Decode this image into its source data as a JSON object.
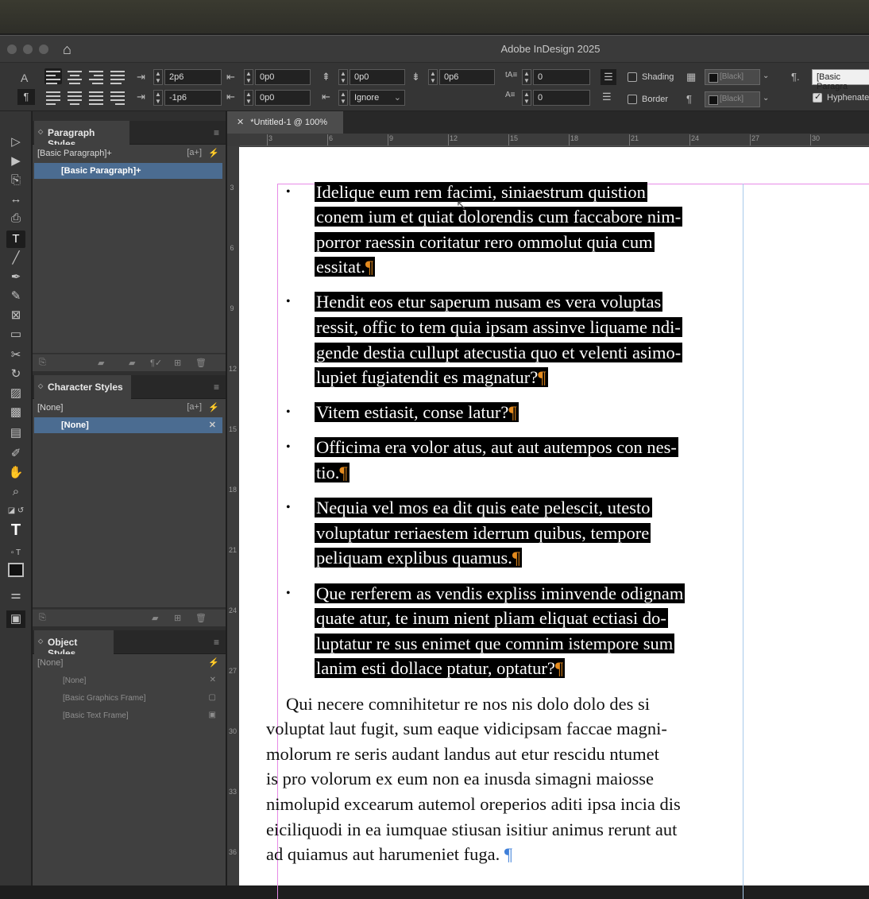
{
  "app": {
    "title": "Adobe InDesign 2025"
  },
  "control": {
    "left_indent": "2p6",
    "first_indent": "-1p6",
    "right_indent": "0p0",
    "last_indent": "0p0",
    "space_before": "0p0",
    "space_after": "0p6",
    "grid_align": "Ignore",
    "drop_lines": "0",
    "drop_chars": "0",
    "shading_label": "Shading",
    "border_label": "Border",
    "shading_swatch": "[Black]",
    "border_swatch": "[Black]",
    "style": "[Basic Paragra",
    "hyphenate_label": "Hyphenate"
  },
  "panels": {
    "paragraph_styles": {
      "title": "Paragraph Styles",
      "current": "[Basic Paragraph]+",
      "items": [
        "[Basic Paragraph]+"
      ]
    },
    "character_styles": {
      "title": "Character Styles",
      "current": "[None]",
      "items": [
        "[None]"
      ]
    },
    "object_styles": {
      "title": "Object Styles",
      "current": "[None]",
      "items": [
        "[None]",
        "[Basic Graphics Frame]",
        "[Basic Text Frame]"
      ]
    }
  },
  "document": {
    "tab": "*Untitled-1 @ 100%",
    "ruler_h": [
      "3",
      "6",
      "9",
      "12",
      "15",
      "18",
      "21",
      "24",
      "27",
      "30"
    ],
    "ruler_v": [
      "3",
      "6",
      "9",
      "12",
      "15",
      "18",
      "21",
      "24",
      "27",
      "30",
      "33",
      "36"
    ],
    "bullet": "•",
    "pilcrow": "¶",
    "lines": [
      "Idelique eum rem facimi, siniaestrum quistion",
      "conem ium et quiat dolorendis cum faccabore nim-",
      "porror raessin coritatur rero ommolut quia cum",
      "essitat.",
      "Hendit eos etur saperum nusam es vera voluptas",
      "ressit, offic to tem quia ipsam assinve liquame ndi-",
      "gende destia cullupt atecustia quo et velenti asimo-",
      "lupiet fugiatendit es magnatur?",
      "Vitem estiasit, conse latur?",
      "Officima era volor atus, aut aut autempos con nes-",
      "tio.",
      "Nequia vel mos ea dit quis eate pelescit, utesto",
      "voluptatur reriaestem iderrum quibus, tempore",
      "peliquam explibus quamus.",
      "Que rerferem as vendis expliss iminvende odignam",
      "quate atur, te inum nient pliam eliquat ectiasi do-",
      "luptatur re sus enimet que comnim istempore sum",
      "lanim esti dollace ptatur, optatur?"
    ],
    "body_lines": [
      "Qui necere comnihitetur re nos nis dolo dolo des si",
      "voluptat laut fugit, sum eaque vidicipsam faccae magni-",
      "molorum re seris audant landus aut etur rescidu ntumet",
      "is pro volorum ex eum non ea inusda simagni maiosse",
      "nimolupid excearum autemol oreperios aditi ipsa incia dis",
      "eiciliquodi in ea iumquae stiusan isitiur animus rerunt aut",
      "ad quiamus aut harumeniet fuga."
    ]
  }
}
